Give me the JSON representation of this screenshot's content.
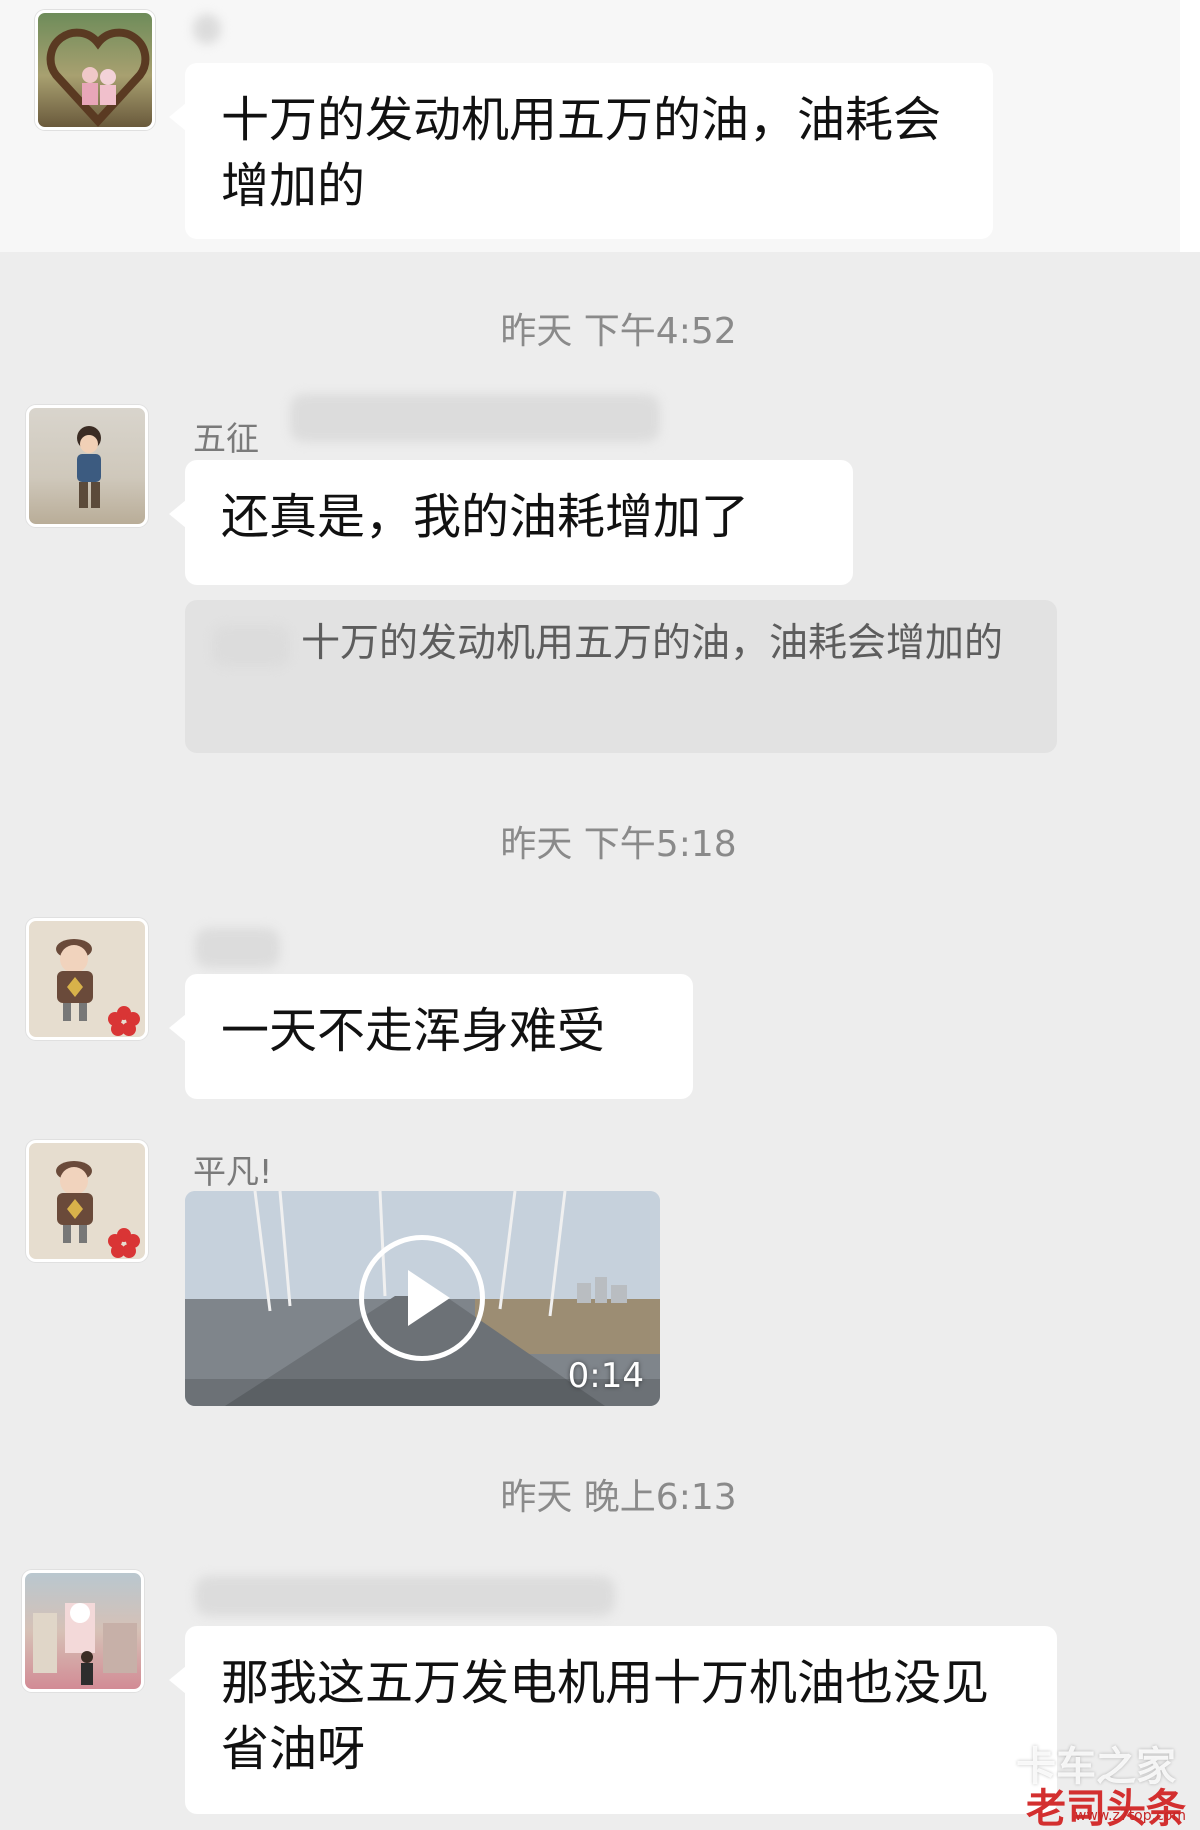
{
  "messages": {
    "m1": {
      "text": "十万的发动机用五万的油，油耗会增加的"
    },
    "m2": {
      "nickname": "五征",
      "text": "还真是，我的油耗增加了",
      "quote": "十万的发动机用五万的油，油耗会增加的"
    },
    "m3": {
      "text": "一天不走浑身难受"
    },
    "m4": {
      "nickname": "平凡!",
      "video_duration": "0:14"
    },
    "m5": {
      "text": "那我这五万发电机用十万机油也没见省油呀"
    }
  },
  "timestamps": [
    "昨天 下午4:52",
    "昨天 下午5:18",
    "昨天 晚上6:13"
  ],
  "watermark": {
    "line1": "卡车之家",
    "line2": "老司头条",
    "url": "www.z7top.com"
  },
  "colors": {
    "background": "#ededed",
    "bubble": "#ffffff",
    "quote": "#e2e2e2",
    "timestamp": "#8a8a8a",
    "watermark_red": "#d32f2f"
  }
}
